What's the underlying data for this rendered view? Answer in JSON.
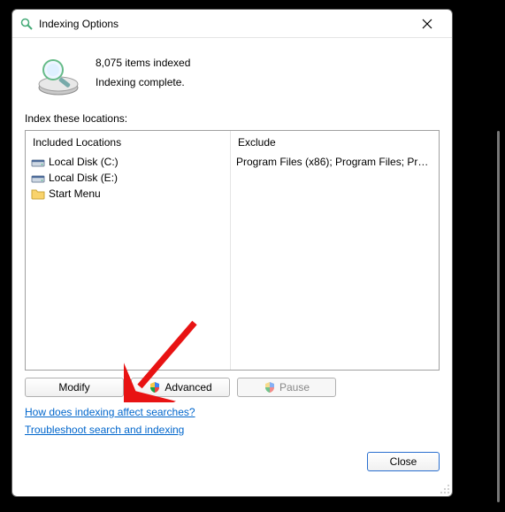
{
  "title": "Indexing Options",
  "status": {
    "count_line": "8,075 items indexed",
    "state_line": "Indexing complete."
  },
  "section_label": "Index these locations:",
  "columns": {
    "included_header": "Included Locations",
    "exclude_header": "Exclude"
  },
  "included": [
    {
      "icon": "disk",
      "label": "Local Disk (C:)"
    },
    {
      "icon": "disk",
      "label": "Local Disk (E:)"
    },
    {
      "icon": "folder",
      "label": "Start Menu"
    }
  ],
  "exclude": [
    {
      "label": "Program Files (x86); Program Files; Progra..."
    },
    {
      "label": ""
    },
    {
      "label": ""
    }
  ],
  "buttons": {
    "modify": "Modify",
    "advanced": "Advanced",
    "pause": "Pause",
    "close": "Close"
  },
  "links": {
    "how": "How does indexing affect searches?",
    "trouble": "Troubleshoot search and indexing"
  },
  "colors": {
    "link": "#0066cc",
    "arrow": "#e81313"
  }
}
